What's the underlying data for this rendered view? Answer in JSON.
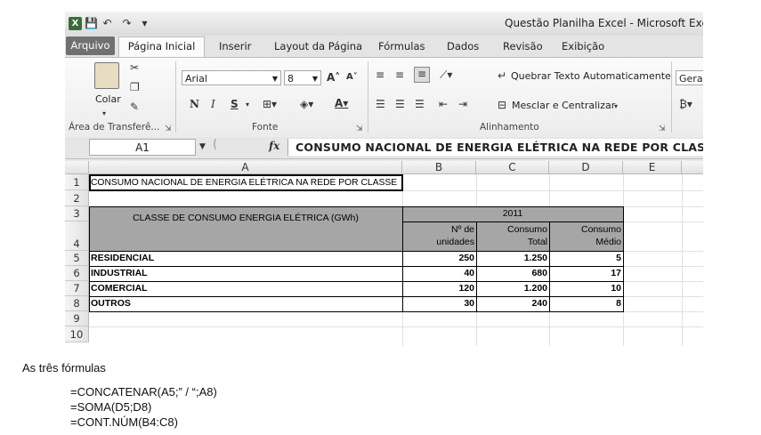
{
  "window": {
    "title": "Questão Planilha Excel  -  Microsoft Excel",
    "quick_access": {
      "save": "💾",
      "undo": "↶",
      "redo": "↷",
      "more": "▾"
    }
  },
  "tabs": [
    "Arquivo",
    "Página Inicial",
    "Inserir",
    "Layout da Página",
    "Fórmulas",
    "Dados",
    "Revisão",
    "Exibição"
  ],
  "ribbon": {
    "clipboard": {
      "paste_label": "Colar",
      "group_label": "Área de Transferê..."
    },
    "font": {
      "font_name": "Arial",
      "font_size": "8",
      "bold": "N",
      "italic": "I",
      "underline": "S",
      "group_label": "Fonte"
    },
    "alignment": {
      "wrap_text": "Quebrar Texto Automaticamente",
      "merge_center": "Mesclar e Centralizar",
      "group_label": "Alinhamento"
    },
    "number": {
      "format": "Geral"
    }
  },
  "formula_bar": {
    "name_box": "A1",
    "fx": "fx",
    "formula": "CONSUMO NACIONAL DE ENERGIA ELÉTRICA NA REDE POR CLASSE"
  },
  "columns": [
    "A",
    "B",
    "C",
    "D",
    "E"
  ],
  "rows": [
    "1",
    "2",
    "3",
    "4",
    "5",
    "6",
    "7",
    "8",
    "9",
    "10"
  ],
  "sheet": {
    "a1": "CONSUMO NACIONAL DE ENERGIA ELÉTRICA NA REDE POR CLASSE",
    "class_header": "CLASSE DE CONSUMO ENERGIA ELÉTRICA (GWh)",
    "year": "2011",
    "b4": [
      "Nº de",
      "unidades"
    ],
    "c4": [
      "Consumo",
      "Total"
    ],
    "d4": [
      "Consumo",
      "Médio"
    ],
    "data": [
      {
        "classe": "RESIDENCIAL",
        "unidades": "250",
        "total": "1.250",
        "medio": "5"
      },
      {
        "classe": "INDUSTRIAL",
        "unidades": "40",
        "total": "680",
        "medio": "17"
      },
      {
        "classe": "COMERCIAL",
        "unidades": "120",
        "total": "1.200",
        "medio": "10"
      },
      {
        "classe": "OUTROS",
        "unidades": "30",
        "total": "240",
        "medio": "8"
      }
    ]
  },
  "below": {
    "intro": "As três fórmulas",
    "formulas": [
      "=CONCATENAR(A5;” / “;A8)",
      "=SOMA(D5;D8)",
      "=CONT.NÚM(B4:C8)"
    ]
  }
}
